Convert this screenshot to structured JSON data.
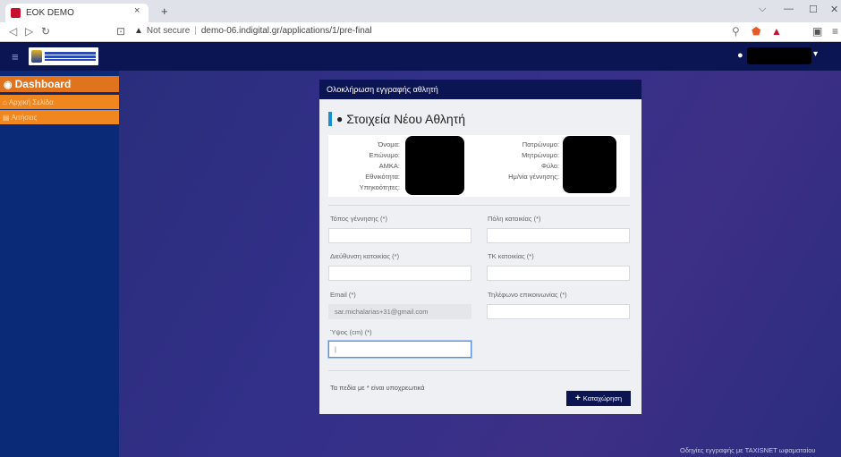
{
  "browser": {
    "tab_title": "EOK DEMO",
    "tab_close": "×",
    "new_tab": "+",
    "warn_icon": "▲",
    "security_label": "Not secure",
    "url_separator": "|",
    "url": "demo-06.indigital.gr/applications/1/pre-final"
  },
  "header": {
    "menu_icon": "≡",
    "user_icon": "user-icon"
  },
  "sidebar": {
    "title": "Dashboard",
    "items": [
      {
        "label": "Αρχική Σελίδα",
        "icon": "home-icon"
      },
      {
        "label": "Αιτήσεις",
        "icon": "file-icon"
      }
    ]
  },
  "card": {
    "header": "Ολοκλήρωση εγγραφής αθλητή",
    "title": "Στοιχεία Νέου Αθλητή",
    "info_left": [
      "Όνομα:",
      "Επώνυμο:",
      "ΑΜΚΑ:",
      "Εθνικότητα:",
      "Υπηκοότητες:"
    ],
    "info_right": [
      "Πατρώνυμο:",
      "Μητρώνυμο:",
      "Φύλο:",
      "Ημ/νία γέννησης:"
    ],
    "fields": {
      "birthplace": {
        "label": "Τόπος γέννησης (*)",
        "value": ""
      },
      "city": {
        "label": "Πόλη κατοικίας (*)",
        "value": ""
      },
      "address": {
        "label": "Διεύθυνση κατοικίας (*)",
        "value": ""
      },
      "postcode": {
        "label": "ΤΚ κατοικίας (*)",
        "value": ""
      },
      "email": {
        "label": "Email (*)",
        "value": "sar.michalarias+31@gmail.com"
      },
      "phone": {
        "label": "Τηλέφωνο επικοινωνίας (*)",
        "value": ""
      },
      "height": {
        "label": "Ύψος (cm) (*)",
        "value": "|"
      }
    },
    "note": "Τα πεδία με * είναι υποχρεωτικά",
    "submit_label": "Καταχώρηση",
    "submit_plus": "+"
  },
  "footer": {
    "link": "Οδηγίες εγγραφής με TAXISNET ωφαματαίου"
  },
  "colors": {
    "header_bg": "#0c1554",
    "sidebar_bg": "#0a2a78",
    "menu_orange": "#f0861e",
    "accent_blue": "#1a8fd0"
  }
}
